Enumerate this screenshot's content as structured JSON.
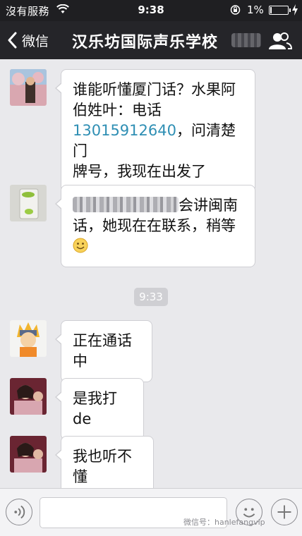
{
  "status_bar": {
    "carrier": "沒有服務",
    "time": "9:38",
    "battery_percent": "1%",
    "battery_level": 0.01
  },
  "nav": {
    "back_label": "微信",
    "title": "汉乐坊国际声乐学校"
  },
  "messages": [
    {
      "lines": [
        "谁能听懂厦门话？水果阿",
        "伯姓叶：电话"
      ],
      "phone": "13015912640",
      "phone_suffix": "，问清楚门",
      "last_line": "牌号，我现在出发了"
    },
    {
      "line1_suffix": "会讲闽南",
      "line2": "话，她现在在联系，稍等",
      "emoji": "smiley-emoji"
    },
    {
      "text": "正在通话中"
    },
    {
      "text": "是我打de"
    },
    {
      "text": "我也听不懂"
    }
  ],
  "time_separator": "9:33",
  "input_bar": {
    "placeholder": "",
    "watermark": "微信号：hanlefangvip"
  },
  "icons": [
    "wifi-icon",
    "lock-rotation-icon",
    "battery-icon",
    "charging-icon",
    "back-chevron-icon",
    "group-members-icon",
    "voice-icon",
    "emoji-icon",
    "plus-icon"
  ]
}
